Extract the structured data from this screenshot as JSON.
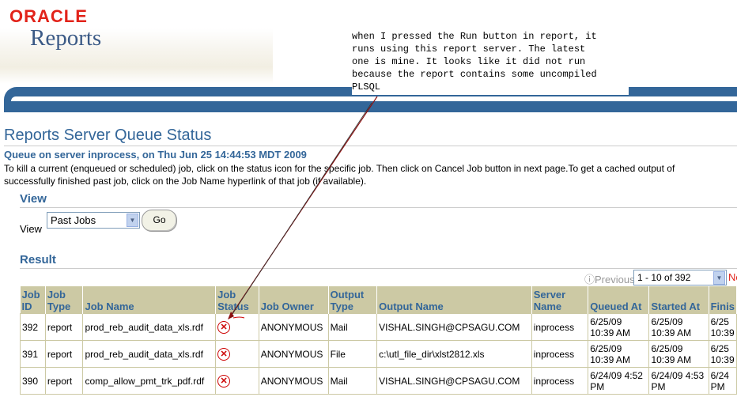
{
  "brand": {
    "oracle": "ORACLE",
    "product": "Reports"
  },
  "annotation": "when I pressed the Run button in report, it\nruns using this report server. The latest\none is mine. It looks like it did not run\nbecause the report contains some uncompiled\nPLSQL",
  "page": {
    "title": "Reports Server Queue Status",
    "queue_line": "Queue on server inprocess, on Thu Jun 25 14:44:53 MDT 2009",
    "instructions_1": "To kill a current (enqueued or scheduled) job, click on the status icon for the specific job. Then click on Cancel Job button in next page.To get a cached output of",
    "instructions_2": "successfully finished past job, click on the Job Name hyperlink of that job (if available)."
  },
  "view": {
    "heading": "View",
    "label": "View",
    "selected": "Past Jobs",
    "go_label": "Go"
  },
  "result": {
    "heading": "Result",
    "previous_label": "Previous",
    "range": "1 - 10 of 392",
    "next_label": "Ne",
    "columns": [
      "Job ID",
      "Job Type",
      "Job Name",
      "Job Status",
      "Job Owner",
      "Output Type",
      "Output Name",
      "Server Name",
      "Queued At",
      "Started At",
      "Finis"
    ],
    "rows": [
      {
        "id": "392",
        "type": "report",
        "name": "prod_reb_audit_data_xls.rdf",
        "owner": "ANONYMOUS",
        "otype": "Mail",
        "oname": "VISHAL.SINGH@CPSAGU.COM",
        "server": "inprocess",
        "queued": "6/25/09 10:39 AM",
        "started": "6/25/09 10:39 AM",
        "finished": "6/25 10:39"
      },
      {
        "id": "391",
        "type": "report",
        "name": "prod_reb_audit_data_xls.rdf",
        "owner": "ANONYMOUS",
        "otype": "File",
        "oname": "c:\\utl_file_dir\\xlst2812.xls",
        "server": "inprocess",
        "queued": "6/25/09 10:39 AM",
        "started": "6/25/09 10:39 AM",
        "finished": "6/25 10:39"
      },
      {
        "id": "390",
        "type": "report",
        "name": "comp_allow_pmt_trk_pdf.rdf",
        "owner": "ANONYMOUS",
        "otype": "Mail",
        "oname": "VISHAL.SINGH@CPSAGU.COM",
        "server": "inprocess",
        "queued": "6/24/09 4:52 PM",
        "started": "6/24/09 4:53 PM",
        "finished": "6/24 PM"
      }
    ],
    "status_icon": "error-x-icon"
  },
  "colors": {
    "oracle_red": "#e2231a",
    "brand_blue": "#336699",
    "table_header": "#ccc9a4"
  }
}
